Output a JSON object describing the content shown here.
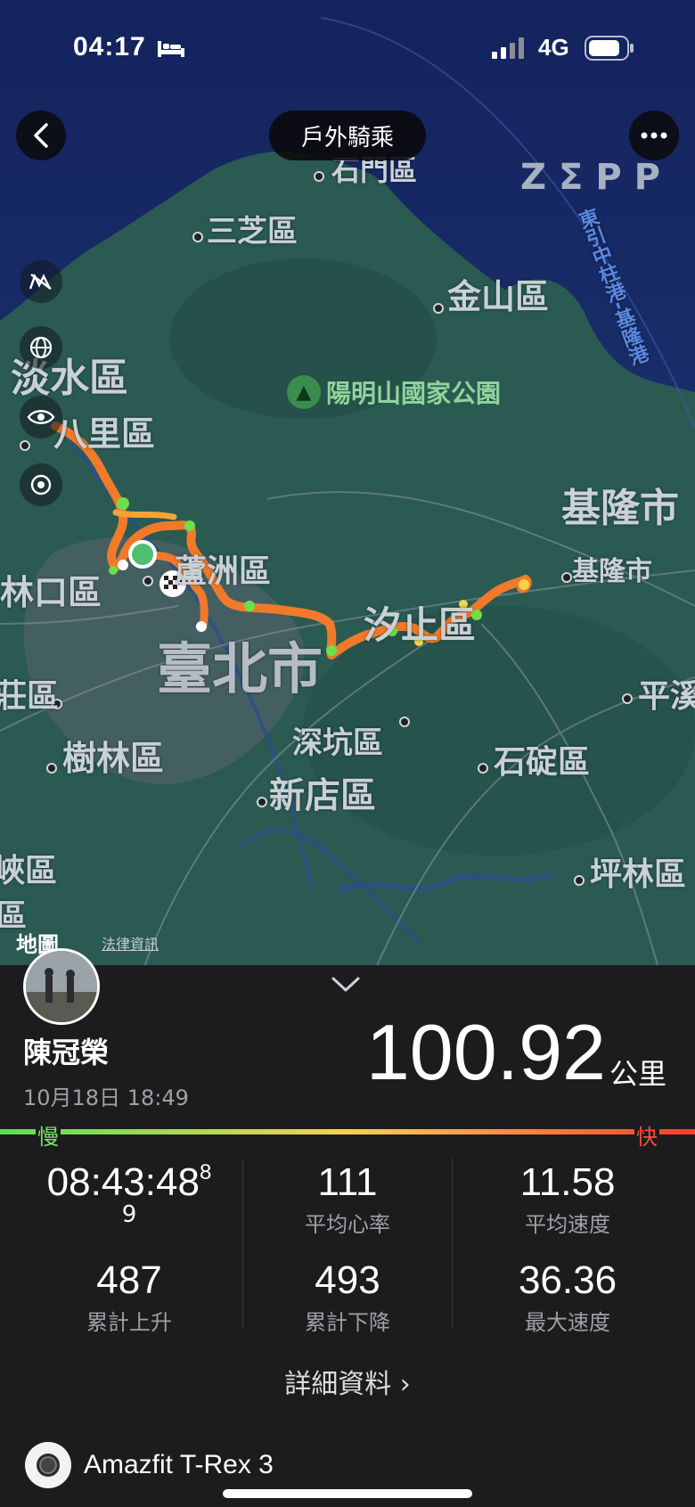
{
  "status_bar": {
    "time": "04:17",
    "network": "4G"
  },
  "header": {
    "title": "戶外騎乘"
  },
  "brand": {
    "watermark": "ZΣPP"
  },
  "map": {
    "labels": {
      "shimen": "石門區",
      "sanzhi": "三芝區",
      "jinshan": "金山區",
      "tamsui": "淡水區",
      "bali": "八里區",
      "park": "陽明山國家公園",
      "keelung_city": "基隆市",
      "keelung_small": "基隆市",
      "luzhou": "蘆洲區",
      "linkou": "林口區",
      "taipei": "臺北市",
      "xizhi": "汐止區",
      "shulin_edge": "莊區",
      "shulin": "樹林區",
      "shenkeng": "深坑區",
      "shiding": "石碇區",
      "pingxi": "平溪",
      "xindian": "新店區",
      "sanxia_edge": "峽區",
      "pinglin": "坪林區",
      "edge_bottom": "區",
      "highway": "東引中柱港-基隆港"
    },
    "apple_maps": "地圖",
    "legal": "法律資訊"
  },
  "activity": {
    "user_name": "陳冠榮",
    "date_time": "10月18日 18:49",
    "distance": "100.92",
    "distance_unit": "公里",
    "speed_scale": {
      "slow": "慢",
      "fast": "快"
    },
    "stats": [
      {
        "value": "08:43:48",
        "sup": "8",
        "sub": "9",
        "label": ""
      },
      {
        "value": "111",
        "label": "平均心率"
      },
      {
        "value": "11.58",
        "label": "平均速度"
      },
      {
        "value": "487",
        "label": "累計上升"
      },
      {
        "value": "493",
        "label": "累計下降"
      },
      {
        "value": "36.36",
        "label": "最大速度"
      }
    ],
    "details_link": "詳細資料 ›"
  },
  "device": {
    "name": "Amazfit T-Rex 3"
  },
  "colors": {
    "route_main": "#f07a2a",
    "route_slow": "#6be04a",
    "route_fast": "#f5b43a",
    "map_land": "#2a5a52",
    "sea": "#1a2d6b"
  }
}
